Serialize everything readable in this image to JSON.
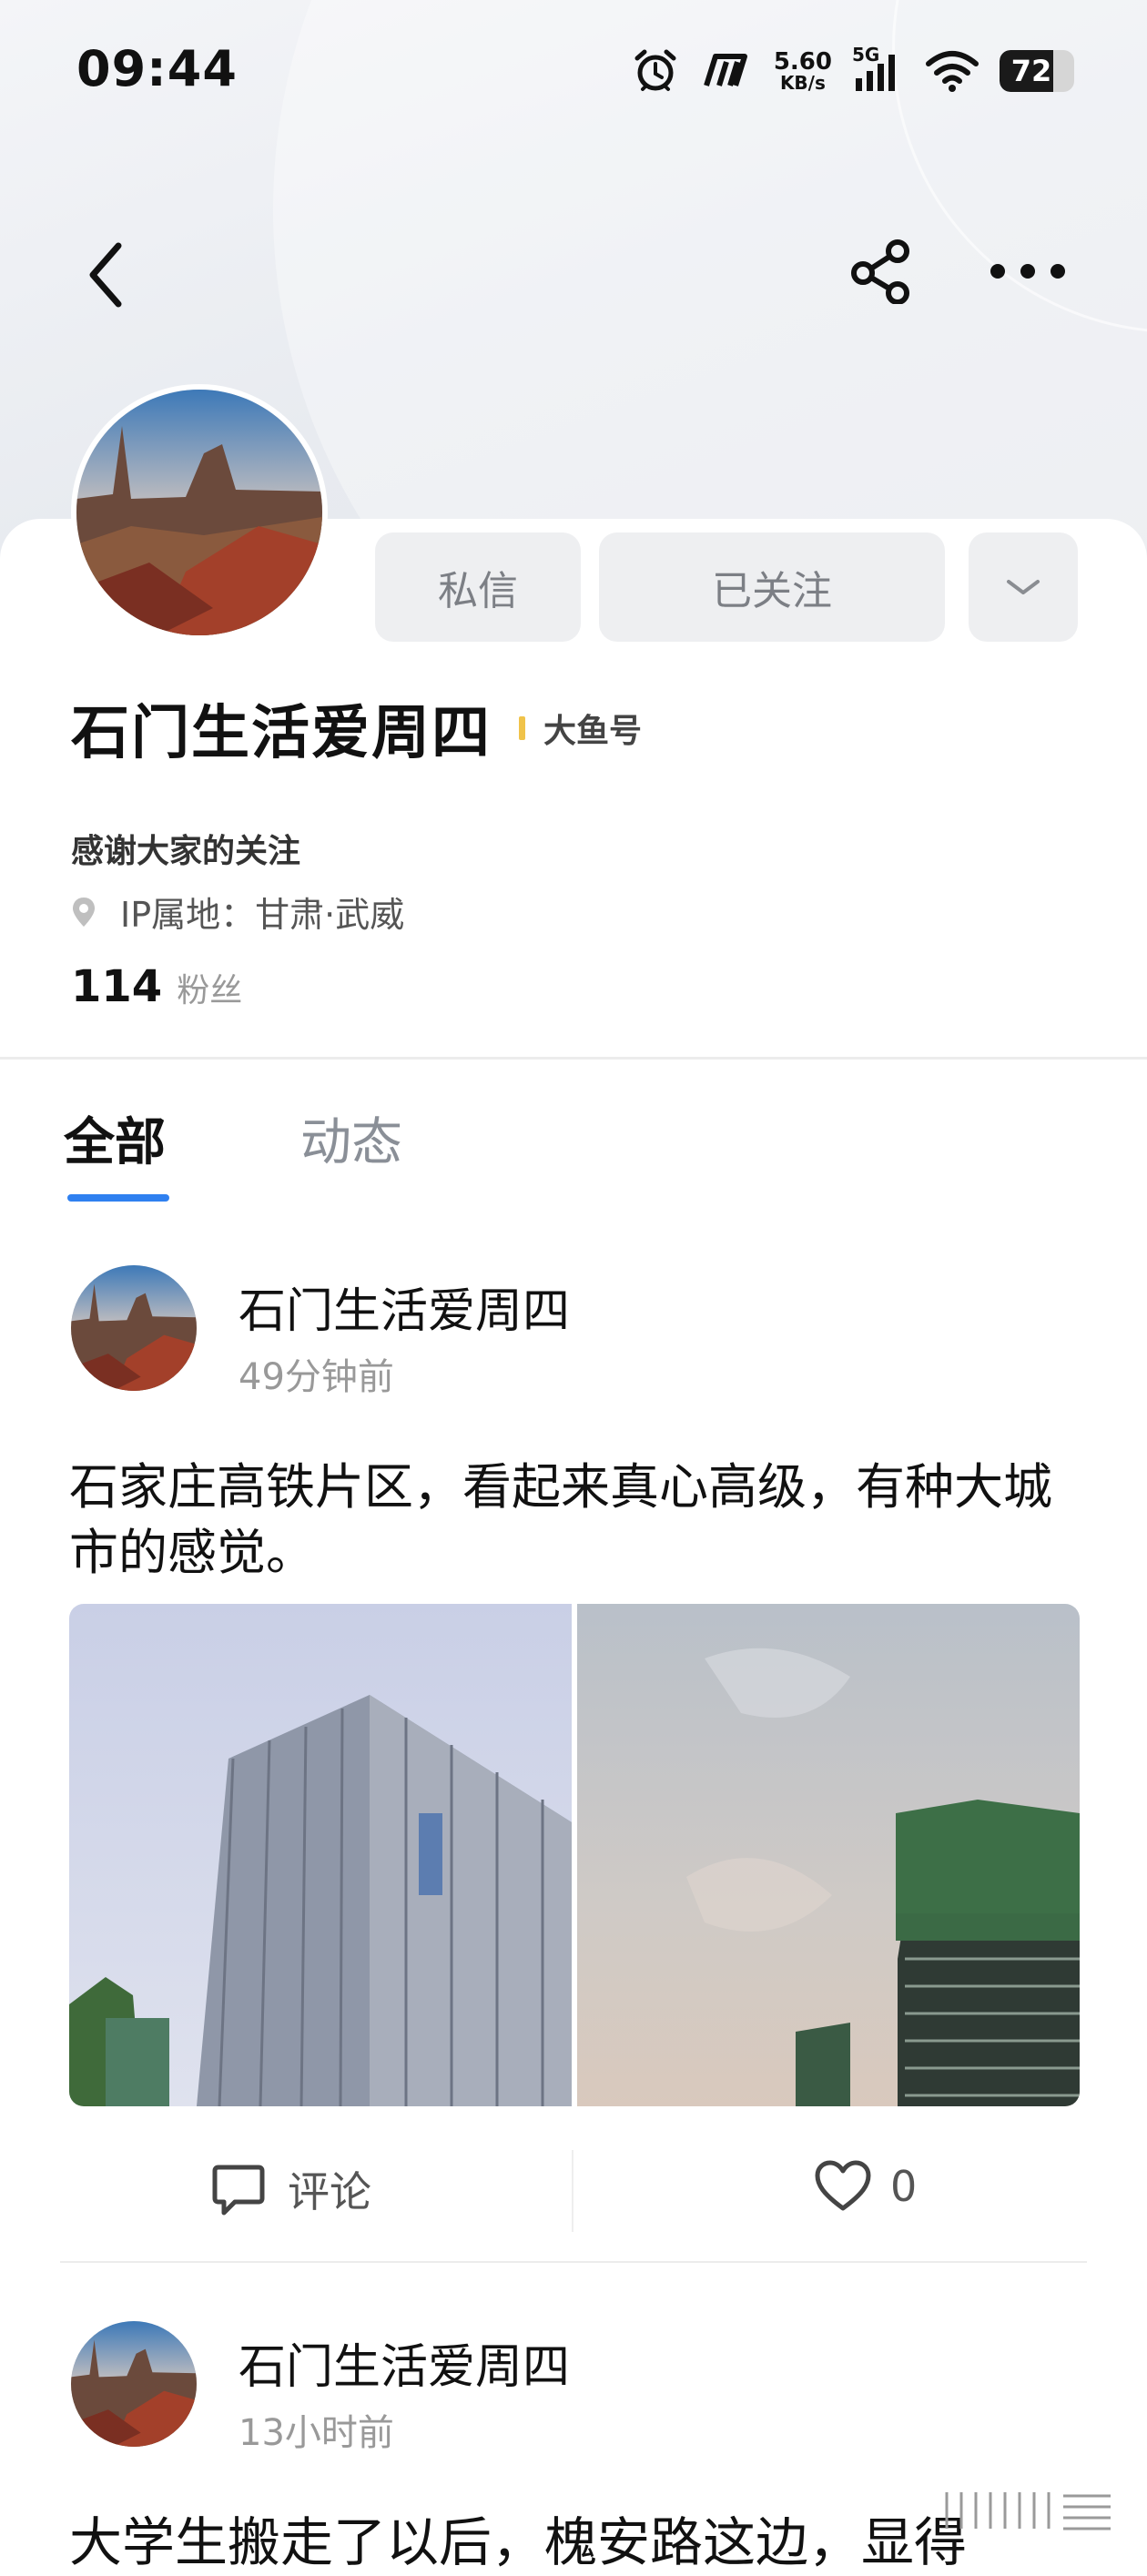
{
  "status_bar": {
    "time": "09:44",
    "net_speed_value": "5.60",
    "net_speed_unit": "KB/s",
    "network": "5G",
    "battery": "72",
    "battery_level": 0.72
  },
  "nav": {
    "back_icon": "chevron-left-icon",
    "share_icon": "share-icon",
    "more_icon": "more-dots-icon"
  },
  "profile": {
    "name": "石门生活爱周四",
    "badge": "大鱼号",
    "bio": "感谢大家的关注",
    "ip_location": "IP属地：甘肃·武威",
    "fans_count": "114",
    "fans_label": "粉丝",
    "buttons": {
      "message": "私信",
      "follow": "已关注"
    }
  },
  "tabs": [
    {
      "label": "全部",
      "active": true
    },
    {
      "label": "动态",
      "active": false
    }
  ],
  "posts": [
    {
      "author": "石门生活爱周四",
      "time": "49分钟前",
      "text": "石家庄高铁片区，看起来真心高级，有种大城市的感觉。",
      "comment_label": "评论",
      "like_count": "0"
    },
    {
      "author": "石门生活爱周四",
      "time": "13小时前",
      "text": "大学生搬走了以后，槐安路这边，显得"
    }
  ],
  "colors": {
    "accent": "#2f80f0",
    "badge_bar": "#f0c34a",
    "button_bg": "#eeeff1"
  }
}
